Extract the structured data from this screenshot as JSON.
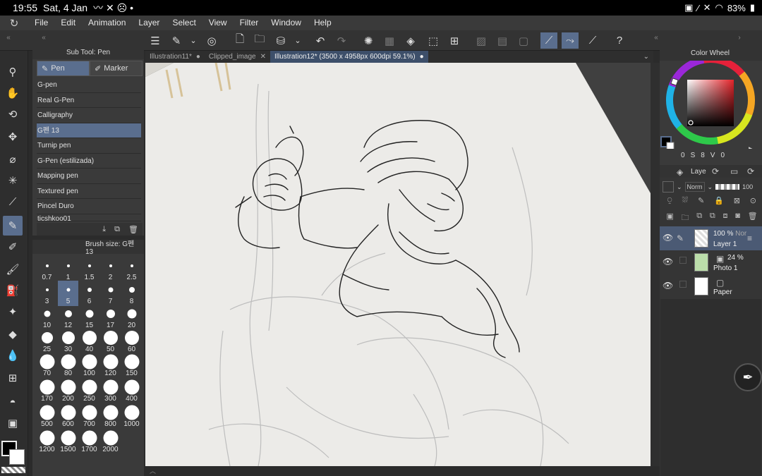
{
  "status": {
    "time": "19:55",
    "date": "Sat, 4 Jan",
    "battery": "83%"
  },
  "menu": {
    "items": [
      "File",
      "Edit",
      "Animation",
      "Layer",
      "Select",
      "View",
      "Filter",
      "Window",
      "Help"
    ]
  },
  "subtool": {
    "title": "Sub Tool: Pen",
    "tabs": [
      "Pen",
      "Marker"
    ],
    "items": [
      "G-pen",
      "Real G-Pen",
      "Calligraphy",
      "G펜 13",
      "Turnip pen",
      "G-Pen (estilizada)",
      "Mapping pen",
      "Textured pen",
      "Pincel Duro",
      "ticshkoo01"
    ],
    "active_index": 3
  },
  "brush": {
    "title": "Brush size: G펜 13",
    "sizes": [
      "0.7",
      "1",
      "1.5",
      "2",
      "2.5",
      "3",
      "5",
      "6",
      "7",
      "8",
      "10",
      "12",
      "15",
      "17",
      "20",
      "25",
      "30",
      "40",
      "50",
      "60",
      "70",
      "80",
      "100",
      "120",
      "150",
      "170",
      "200",
      "250",
      "300",
      "400",
      "500",
      "600",
      "700",
      "800",
      "1000",
      "1200",
      "1500",
      "1700",
      "2000"
    ],
    "active_size": "5"
  },
  "documents": {
    "tabs": [
      {
        "label": "Illustration11*",
        "active": false
      },
      {
        "label": "Clipped_image",
        "active": false
      },
      {
        "label": "Illustration12* (3500 x 4958px 600dpi 59.1%)",
        "active": true
      }
    ]
  },
  "color_wheel": {
    "title": "Color Wheel",
    "readout": [
      "0",
      "S",
      "8",
      "V",
      "0"
    ],
    "current_color": "#000000"
  },
  "layers": {
    "title": "Laye",
    "blend_mode": "Norm",
    "opacity": "100",
    "items": [
      {
        "name": "Layer 1",
        "opacity": "100 %",
        "mode": "Nor",
        "active": true
      },
      {
        "name": "Photo 1",
        "opacity": "24 %",
        "mode": "",
        "active": false
      },
      {
        "name": "Paper",
        "opacity": "",
        "mode": "",
        "active": false
      }
    ]
  },
  "colors": {
    "accent": "#5a6e8e",
    "panel": "#3a3a3a",
    "canvas_paper": "#eeeeec"
  }
}
